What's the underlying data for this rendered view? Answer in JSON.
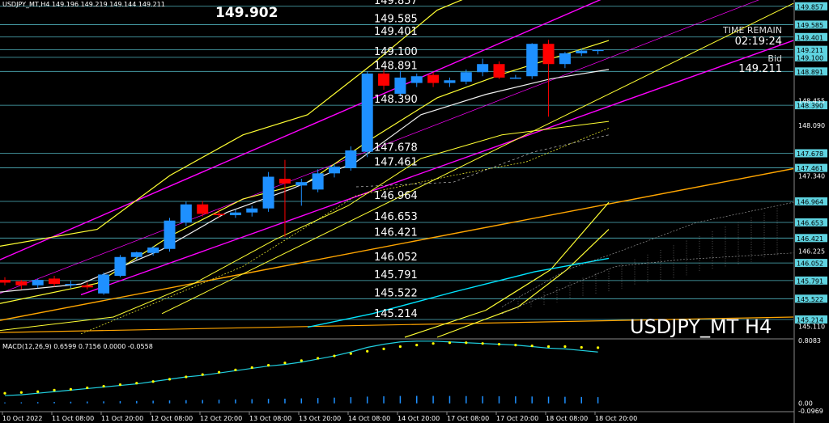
{
  "header": {
    "text": "USDJPY_MT,H4  149.196 149.219 149.144 149.211"
  },
  "big_price": "149.902",
  "time_remain": {
    "label": "TIME REMAIN",
    "value": "02:19:24"
  },
  "bid": {
    "label": "Bid",
    "value": "149.211"
  },
  "symbol_label": "USDJPY_MT H4",
  "macd": {
    "label": "MACD(12,26,9) 0.6599 0.7156 0.0000 -0.0558",
    "ticks": [
      "0.8083",
      "0.00",
      "-0.0969"
    ]
  },
  "colors": {
    "background": "#000000",
    "bull": "#1e90ff",
    "bear": "#ff0000",
    "level": "#5fd3e0",
    "channel": "#ff00ff",
    "bands": "#ffff33",
    "trend": "#ffa500",
    "ma": "#f0f0f0",
    "cyan_ma": "#00e5ff",
    "signal_dots": "#ffff00",
    "macd_line": "#20d0e0",
    "macd_hist": "#1e90ff"
  },
  "chart_data": {
    "type": "candlestick",
    "ylim": [
      144.95,
      149.95
    ],
    "x_tick_labels": [
      "10 Oct 2022",
      "11 Oct 08:00",
      "11 Oct 20:00",
      "12 Oct 08:00",
      "12 Oct 20:00",
      "13 Oct 08:00",
      "13 Oct 20:00",
      "14 Oct 08:00",
      "14 Oct 20:00",
      "17 Oct 08:00",
      "17 Oct 20:00",
      "18 Oct 08:00",
      "18 Oct 20:00"
    ],
    "price_ticks": [
      "148.455",
      "148.090",
      "147.340",
      "146.225",
      "145.110"
    ],
    "level_prices": [
      149.857,
      149.585,
      149.401,
      149.211,
      149.1,
      148.891,
      148.39,
      147.678,
      147.461,
      146.964,
      146.653,
      146.421,
      146.052,
      145.791,
      145.522,
      145.214
    ],
    "level_labels": [
      "149.857",
      "149.585",
      "149.401",
      "149.211",
      "149.100",
      "148.891",
      "148.390",
      "147.678",
      "147.461",
      "146.964",
      "146.653",
      "146.421",
      "146.052",
      "145.791",
      "145.522",
      "145.214"
    ],
    "chart_level_labels": [
      "149.857",
      "149.585",
      "149.401",
      "149.100",
      "148.891",
      "148.390",
      "147.678",
      "147.461",
      "146.964",
      "146.653",
      "146.421",
      "146.052",
      "145.791",
      "145.522",
      "145.214"
    ],
    "candles": [
      {
        "o": 145.8,
        "h": 145.84,
        "l": 145.72,
        "c": 145.76
      },
      {
        "o": 145.78,
        "h": 145.8,
        "l": 145.66,
        "c": 145.72
      },
      {
        "o": 145.72,
        "h": 145.82,
        "l": 145.68,
        "c": 145.8
      },
      {
        "o": 145.82,
        "h": 145.86,
        "l": 145.7,
        "c": 145.74
      },
      {
        "o": 145.74,
        "h": 145.79,
        "l": 145.68,
        "c": 145.74
      },
      {
        "o": 145.72,
        "h": 145.76,
        "l": 145.66,
        "c": 145.69
      },
      {
        "o": 145.6,
        "h": 145.91,
        "l": 145.58,
        "c": 145.88
      },
      {
        "o": 145.86,
        "h": 146.17,
        "l": 145.84,
        "c": 146.14
      },
      {
        "o": 146.14,
        "h": 146.22,
        "l": 146.1,
        "c": 146.21
      },
      {
        "o": 146.2,
        "h": 146.3,
        "l": 146.16,
        "c": 146.28
      },
      {
        "o": 146.26,
        "h": 146.72,
        "l": 146.22,
        "c": 146.68
      },
      {
        "o": 146.65,
        "h": 146.96,
        "l": 146.6,
        "c": 146.92
      },
      {
        "o": 146.92,
        "h": 146.97,
        "l": 146.74,
        "c": 146.78
      },
      {
        "o": 146.78,
        "h": 146.85,
        "l": 146.72,
        "c": 146.76
      },
      {
        "o": 146.76,
        "h": 146.84,
        "l": 146.72,
        "c": 146.8
      },
      {
        "o": 146.8,
        "h": 146.9,
        "l": 146.74,
        "c": 146.86
      },
      {
        "o": 146.86,
        "h": 147.4,
        "l": 146.81,
        "c": 147.33
      },
      {
        "o": 147.3,
        "h": 147.58,
        "l": 146.44,
        "c": 147.23
      },
      {
        "o": 147.2,
        "h": 147.3,
        "l": 146.9,
        "c": 147.25
      },
      {
        "o": 147.14,
        "h": 147.44,
        "l": 147.1,
        "c": 147.38
      },
      {
        "o": 147.38,
        "h": 147.52,
        "l": 147.32,
        "c": 147.48
      },
      {
        "o": 147.46,
        "h": 147.78,
        "l": 147.42,
        "c": 147.72
      },
      {
        "o": 147.7,
        "h": 148.89,
        "l": 147.62,
        "c": 148.86
      },
      {
        "o": 148.86,
        "h": 148.92,
        "l": 148.62,
        "c": 148.68
      },
      {
        "o": 148.56,
        "h": 148.9,
        "l": 148.52,
        "c": 148.8
      },
      {
        "o": 148.72,
        "h": 148.86,
        "l": 148.66,
        "c": 148.82
      },
      {
        "o": 148.84,
        "h": 148.88,
        "l": 148.66,
        "c": 148.72
      },
      {
        "o": 148.72,
        "h": 148.8,
        "l": 148.66,
        "c": 148.76
      },
      {
        "o": 148.74,
        "h": 148.92,
        "l": 148.7,
        "c": 148.88
      },
      {
        "o": 148.88,
        "h": 149.08,
        "l": 148.82,
        "c": 149.0
      },
      {
        "o": 149.0,
        "h": 149.04,
        "l": 148.78,
        "c": 148.8
      },
      {
        "o": 148.8,
        "h": 148.84,
        "l": 148.78,
        "c": 148.8
      },
      {
        "o": 148.82,
        "h": 149.31,
        "l": 148.78,
        "c": 149.3
      },
      {
        "o": 149.3,
        "h": 149.36,
        "l": 148.22,
        "c": 149.0
      },
      {
        "o": 149.0,
        "h": 149.18,
        "l": 148.94,
        "c": 149.16
      },
      {
        "o": 149.16,
        "h": 149.23,
        "l": 149.12,
        "c": 149.2
      },
      {
        "o": 149.196,
        "h": 149.219,
        "l": 149.144,
        "c": 149.211
      }
    ],
    "macd_signal": [
      0.13,
      0.14,
      0.15,
      0.17,
      0.18,
      0.2,
      0.22,
      0.24,
      0.26,
      0.28,
      0.31,
      0.34,
      0.37,
      0.4,
      0.43,
      0.46,
      0.49,
      0.52,
      0.55,
      0.58,
      0.61,
      0.64,
      0.67,
      0.7,
      0.73,
      0.75,
      0.77,
      0.78,
      0.78,
      0.77,
      0.76,
      0.75,
      0.74,
      0.73,
      0.73,
      0.72,
      0.7156
    ],
    "macd_line": [
      0.1,
      0.11,
      0.13,
      0.15,
      0.17,
      0.19,
      0.21,
      0.23,
      0.25,
      0.28,
      0.31,
      0.34,
      0.36,
      0.39,
      0.42,
      0.45,
      0.48,
      0.5,
      0.53,
      0.57,
      0.61,
      0.66,
      0.72,
      0.76,
      0.79,
      0.8,
      0.8,
      0.79,
      0.78,
      0.77,
      0.76,
      0.75,
      0.73,
      0.71,
      0.7,
      0.68,
      0.6599
    ]
  }
}
